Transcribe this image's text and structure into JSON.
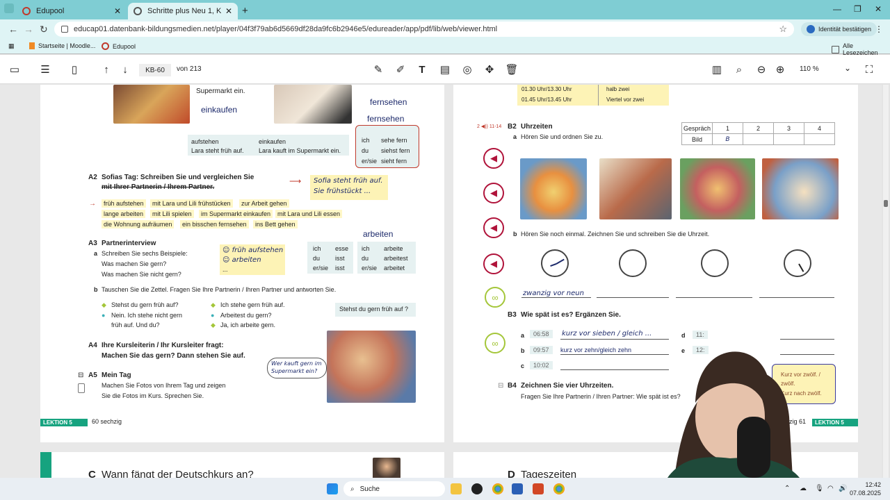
{
  "browser": {
    "tabs": [
      {
        "label": "Edupool",
        "active": false
      },
      {
        "label": "Schritte plus Neu 1, Kurs- und /",
        "active": true
      }
    ],
    "url": "educap01.datenbank-bildungsmedien.net/player/04f3f79ab6d5669df28da9fc6b2946e5/edureader/app/pdf/lib/web/viewer.html",
    "identity_button": "Identität bestätigen",
    "bookmarks": [
      "Startseite | Moodle...",
      "Edupool"
    ],
    "all_bookmarks": "Alle Lesezeichen"
  },
  "viewer_toolbar": {
    "page_input": "KB-60",
    "page_count": "von 213",
    "zoom": "110 %"
  },
  "left_page": {
    "supermarkt_text": "Supermarkt ein.",
    "einkaufen_hw": "einkaufen",
    "fernsehen_hw1": "fernsehen",
    "fernsehen_hw2": "fernsehen",
    "aufstehen": "aufstehen",
    "lara_steht": "Lara steht früh auf.",
    "einkaufen": "einkaufen",
    "lara_kauft": "Lara kauft im Supermarkt ein.",
    "conj_fern": [
      [
        "ich",
        "sehe fern"
      ],
      [
        "du",
        "siehst fern"
      ],
      [
        "er/sie",
        "sieht fern"
      ]
    ],
    "a2_label": "A2",
    "a2_title": "Sofias Tag: Schreiben Sie und vergleichen Sie",
    "a2_title2": "mit Ihrer Partnerin / Ihrem Partner.",
    "a2_hw1": "Sofia steht früh auf.",
    "a2_hw2": "Sie frühstückt ...",
    "chips_row1": [
      "früh aufstehen",
      "mit Lara und Lili frühstücken",
      "zur Arbeit gehen"
    ],
    "chips_row2": [
      "lange arbeiten",
      "mit Lili spielen",
      "im Supermarkt einkaufen",
      "mit Lara und Lili essen"
    ],
    "chips_row3": [
      "die Wohnung aufräumen",
      "ein bisschen fernsehen",
      "ins Bett gehen"
    ],
    "arbeiten_hw": "arbeiten",
    "a3_label": "A3",
    "a3_title": "Partnerinterview",
    "a3_a": "Schreiben Sie sechs Beispiele:",
    "a3_q1": "Was machen Sie gern?",
    "a3_q2": "Was machen Sie nicht gern?",
    "a3_note1": "☺ früh aufstehen",
    "a3_note2": "☺ arbeiten",
    "a3_note3": "...",
    "conj_essen": [
      [
        "ich",
        "esse"
      ],
      [
        "du",
        "isst"
      ],
      [
        "er/sie",
        "isst"
      ]
    ],
    "conj_arbeiten": [
      [
        "ich",
        "arbeite"
      ],
      [
        "du",
        "arbeitest"
      ],
      [
        "er/sie",
        "arbeitet"
      ]
    ],
    "a3_b": "Tauschen Sie die Zettel. Fragen Sie Ihre Partnerin / Ihren Partner und antworten Sie.",
    "dialog_l1": "Stehst du gern früh auf?",
    "dialog_l2": "Nein. Ich stehe nicht gern",
    "dialog_l3": "früh auf. Und du?",
    "dialog_r1": "Ich stehe gern früh auf.",
    "dialog_r2": "Arbeitest du gern?",
    "dialog_r3": "Ja, ich arbeite gern.",
    "grammar_box": "Stehst du gern früh auf ?",
    "a4_label": "A4",
    "a4_text1": "Ihre Kursleiterin / Ihr Kursleiter fragt:",
    "a4_text2": "Machen Sie das gern? Dann stehen Sie auf.",
    "bubble": "Wer kauft gern im Supermarkt ein?",
    "a5_label": "A5",
    "a5_title": "Mein Tag",
    "a5_text1": "Machen Sie Fotos von Ihrem Tag und zeigen",
    "a5_text2": "Sie die Fotos im Kurs. Sprechen Sie.",
    "footer_lektion": "LEKTION 5",
    "footer_page": "60 sechzig"
  },
  "right_page": {
    "times": [
      [
        "01.30 Uhr/13.30 Uhr",
        "halb zwei"
      ],
      [
        "01.45 Uhr/13.45 Uhr",
        "Viertel vor zwei"
      ]
    ],
    "b2_track": "2 ◀)) 11-14",
    "b2_label": "B2",
    "b2_title": "Uhrzeiten",
    "b2_a": "Hören Sie und ordnen Sie zu.",
    "table_header": [
      "Gespräch",
      "1",
      "2",
      "3",
      "4"
    ],
    "table_row": [
      "Bild",
      "B",
      "",
      "",
      ""
    ],
    "pic_labels": [
      "A",
      "B",
      "C",
      "D"
    ],
    "b2_b": "Hören Sie noch einmal. Zeichnen Sie und schreiben Sie die Uhrzeit.",
    "clock_answer1": "zwanzig vor neun",
    "b3_label": "B3",
    "b3_title": "Wie spät ist es? Ergänzen Sie.",
    "b3_items": [
      {
        "letter": "a",
        "time": "06:58",
        "answer": "kurz vor sieben / gleich ..."
      },
      {
        "letter": "b",
        "time": "09:57",
        "answer": "kurz vor zehn/gleich zehn"
      },
      {
        "letter": "c",
        "time": "10:02",
        "answer": ""
      }
    ],
    "b3_d": "d",
    "b3_e": "e",
    "b3_d_time": "11:",
    "b3_e_time": "12:",
    "side_box1": "Kurz vor zwölf. /",
    "side_box2": "zwölf.",
    "side_box3": "Kurz nach zwölf.",
    "b4_label": "B4",
    "b4_title": "Zeichnen Sie vier Uhrzeiten.",
    "b4_text": "Fragen Sie Ihre Partnerin / Ihren Partner: Wie spät ist es?",
    "footer_page": "ndsechzig 61",
    "footer_lektion": "LEKTION 5"
  },
  "next_pages": {
    "left_title_c": "C",
    "left_title": "Wann fängt der Deutschkurs an?",
    "right_title_d": "D",
    "right_title": "Tageszeiten"
  },
  "taskbar": {
    "search": "Suche",
    "time": "12:42",
    "date": "07.08.2025"
  }
}
